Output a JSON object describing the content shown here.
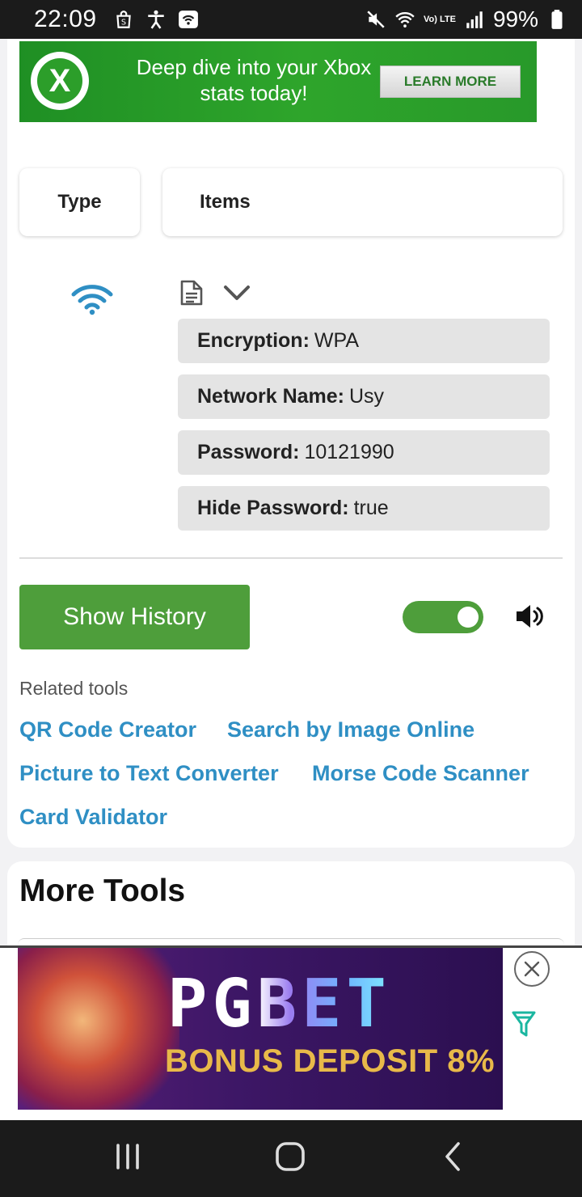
{
  "status_bar": {
    "time": "22:09",
    "battery_percent": "99%",
    "network_label": "Vo) LTE"
  },
  "ad_top": {
    "text": "Deep dive into your Xbox stats today!",
    "button_label": "LEARN MORE",
    "logo_letter": "X"
  },
  "table_header": {
    "type_label": "Type",
    "items_label": "Items"
  },
  "wifi_result": {
    "type_icon": "wifi-icon",
    "fields": [
      {
        "key": "Encryption:",
        "value": "WPA"
      },
      {
        "key": "Network Name:",
        "value": "Usy"
      },
      {
        "key": "Password:",
        "value": "10121990"
      },
      {
        "key": "Hide Password:",
        "value": "true"
      }
    ]
  },
  "controls": {
    "history_button": "Show History",
    "sound_toggle_on": true
  },
  "related": {
    "title": "Related tools",
    "links": [
      "QR Code Creator",
      "Search by Image Online",
      "Picture to Text Converter",
      "Morse Code Scanner",
      "Card Validator"
    ]
  },
  "more_tools": {
    "title": "More Tools"
  },
  "ad_bottom": {
    "brand": "PGBET",
    "tagline": "BONUS DEPOSIT 8%"
  },
  "colors": {
    "accent_green": "#4e9e3b",
    "link_blue": "#2f8fc4",
    "ad_green": "#2ea52b"
  }
}
